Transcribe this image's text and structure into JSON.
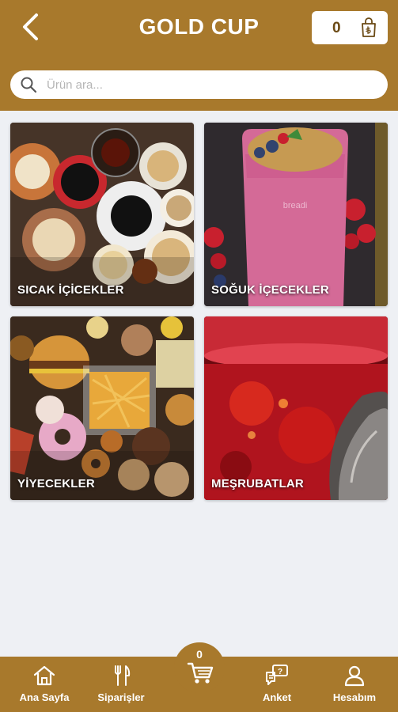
{
  "header": {
    "title": "GOLD CUP",
    "basket_count": "0",
    "back_icon": "chevron-left-icon",
    "basket_icon": "shopping-bag-lira-icon"
  },
  "search": {
    "placeholder": "Ürün ara...",
    "value": "",
    "icon": "search-icon"
  },
  "categories": [
    {
      "label": "SICAK İÇİCEKLER",
      "image": "hot-drinks-coffee-cups"
    },
    {
      "label": "SOĞUK İÇECEKLER",
      "image": "berry-smoothie-glass"
    },
    {
      "label": "YİYECEKLER",
      "image": "burgers-fries-donuts"
    },
    {
      "label": "MEŞRUBATLAR",
      "image": "red-soda-drink"
    }
  ],
  "bottom_nav": {
    "items": [
      {
        "label": "Ana Sayfa",
        "icon": "home-icon"
      },
      {
        "label": "Siparişler",
        "icon": "fork-knife-icon"
      },
      {
        "label": "Anket",
        "icon": "survey-chat-icon"
      },
      {
        "label": "Hesabım",
        "icon": "user-icon"
      }
    ],
    "cart_count": "0",
    "cart_icon": "shopping-cart-icon"
  },
  "colors": {
    "brand": "#a8792c",
    "background": "#eef0f4"
  }
}
